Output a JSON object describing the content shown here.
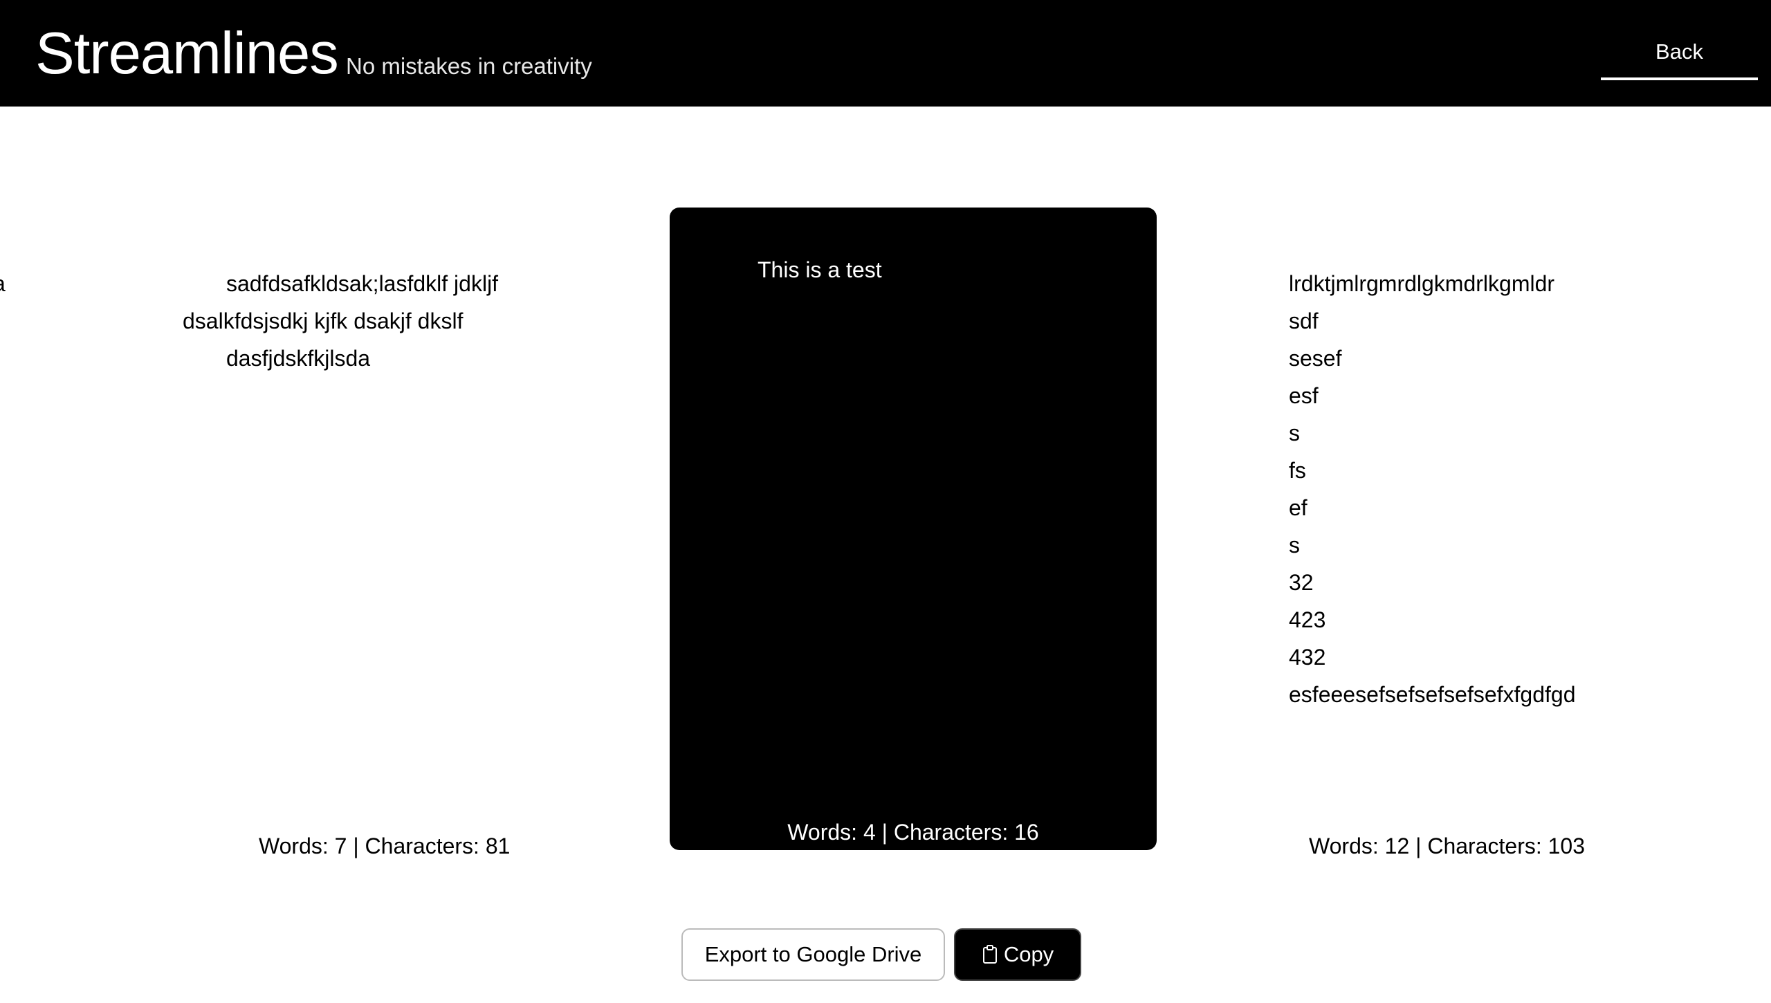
{
  "header": {
    "title": "Streamlines",
    "tagline": "No mistakes in creativity",
    "back_label": "Back"
  },
  "left_panel": {
    "edge_fragment": "a",
    "lines": [
      "sadfdsafkldsak;lasfdklf jdkljf",
      "dsalkfdsjsdkj kjfk dsakjf dkslf",
      "dasfjdskfkjlsda"
    ],
    "stats": "Words: 7 | Characters: 81"
  },
  "center_panel": {
    "text": "This is a test",
    "stats": "Words: 4 | Characters: 16"
  },
  "right_panel": {
    "lines": [
      "lrdktjmlrgmrdlgkmdrlkgmldr",
      "sdf",
      "sesef",
      "esf",
      "s",
      "fs",
      "ef",
      "s",
      "32",
      "423",
      "432",
      "esfeeesefsefsefsefsefxfgdfgd"
    ],
    "stats": "Words: 12 | Characters: 103"
  },
  "actions": {
    "export_label": "Export to Google Drive",
    "copy_label": "Copy",
    "copy_icon": "clipboard-icon"
  }
}
